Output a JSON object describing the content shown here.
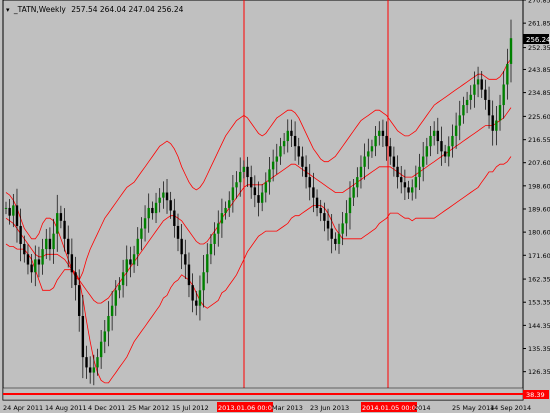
{
  "symbol_label": "_TATN,Weekly",
  "ohlc_label": "257.54 264.04 247.04 256.24",
  "last_price_label": "256.24",
  "indicator_value_label": "38.39",
  "colors": {
    "background": "#c0c0c0",
    "bull_candle": "#008000",
    "bear_candle": "#000000",
    "bands": "#ff0000",
    "vertical_lines": "#ff0000",
    "label_bg_red": "#ff0000",
    "grid": "#a0a0a0"
  },
  "chart_data": {
    "type": "candlestick",
    "title": "",
    "y_axis": {
      "range": [
        120.0,
        270.85
      ],
      "tick_labels": [
        "270.85",
        "261.85",
        "252.35",
        "243.85",
        "234.85",
        "225.60",
        "216.55",
        "207.60",
        "198.60",
        "189.60",
        "180.60",
        "171.60",
        "162.35",
        "153.35",
        "144.35",
        "135.35",
        "126.35"
      ]
    },
    "x_axis": {
      "tick_labels": [
        "24 Apr 2011",
        "14 Aug 2011",
        "4 Dec 2011",
        "25 Mar 2012",
        "15 Jul 2012",
        "2013.01.06 00:00",
        "Mar 2013",
        "23 Jun 2013",
        "2014.01.05 00:00",
        "2014",
        "25 May 2014",
        "14 Sep 2014"
      ]
    },
    "highlighted_dates": [
      "2013.01.06 00:00",
      "2014.01.05 00:00"
    ],
    "series": [
      {
        "name": "price_close_path",
        "values": [
          190,
          187,
          191,
          183,
          176,
          172,
          168,
          165,
          170,
          168,
          174,
          178,
          174,
          180,
          188,
          185,
          178,
          172,
          165,
          160,
          148,
          132,
          128,
          126,
          128,
          132,
          138,
          142,
          148,
          152,
          158,
          160,
          165,
          170,
          168,
          172,
          178,
          182,
          186,
          190,
          188,
          192,
          194,
          196,
          193,
          189,
          183,
          178,
          172,
          168,
          160,
          154,
          152,
          158,
          165,
          172,
          176,
          180,
          184,
          188,
          190,
          193,
          198,
          200,
          204,
          206,
          202,
          198,
          195,
          192,
          196,
          200,
          205,
          208,
          210,
          214,
          216,
          220,
          218,
          214,
          210,
          206,
          202,
          198,
          194,
          190,
          188,
          185,
          182,
          178,
          176,
          180,
          184,
          188,
          194,
          198,
          202,
          206,
          210,
          212,
          214,
          218,
          220,
          218,
          214,
          210,
          206,
          202,
          200,
          198,
          196,
          198,
          202,
          206,
          210,
          214,
          218,
          220,
          216,
          212,
          210,
          214,
          218,
          222,
          226,
          230,
          232,
          234,
          238,
          240,
          236,
          232,
          226,
          220,
          224,
          230,
          238,
          246,
          256
        ]
      },
      {
        "name": "upper_band",
        "values": [
          196,
          195,
          193,
          190,
          186,
          182,
          180,
          178,
          178,
          180,
          184,
          186,
          186,
          185,
          182,
          178,
          174,
          170,
          166,
          163,
          162,
          165,
          170,
          174,
          177,
          180,
          183,
          186,
          188,
          190,
          192,
          194,
          196,
          198,
          199,
          200,
          202,
          204,
          206,
          208,
          210,
          212,
          214,
          215,
          216,
          215,
          213,
          210,
          206,
          203,
          200,
          198,
          197,
          198,
          200,
          203,
          206,
          209,
          212,
          215,
          218,
          220,
          222,
          224,
          225,
          226,
          225,
          223,
          221,
          219,
          218,
          219,
          221,
          223,
          225,
          226,
          227,
          228,
          228,
          227,
          225,
          222,
          219,
          216,
          213,
          211,
          209,
          208,
          208,
          209,
          210,
          212,
          214,
          216,
          218,
          220,
          222,
          224,
          225,
          226,
          227,
          228,
          228,
          227,
          226,
          224,
          222,
          220,
          219,
          218,
          218,
          219,
          220,
          222,
          224,
          226,
          228,
          230,
          231,
          232,
          233,
          234,
          235,
          236,
          237,
          238,
          239,
          240,
          241,
          242,
          242,
          241,
          240,
          240,
          240,
          241,
          243,
          246,
          248
        ]
      },
      {
        "name": "middle_band",
        "values": [
          186,
          185,
          184,
          182,
          180,
          178,
          176,
          174,
          172,
          171,
          171,
          172,
          172,
          172,
          172,
          171,
          170,
          168,
          166,
          164,
          162,
          160,
          158,
          156,
          154,
          153,
          153,
          154,
          155,
          157,
          159,
          161,
          163,
          165,
          167,
          169,
          171,
          173,
          175,
          177,
          179,
          181,
          183,
          185,
          186,
          187,
          187,
          186,
          185,
          183,
          181,
          179,
          177,
          176,
          176,
          177,
          179,
          181,
          183,
          186,
          188,
          190,
          192,
          194,
          196,
          198,
          199,
          199,
          199,
          199,
          199,
          200,
          201,
          202,
          203,
          204,
          205,
          206,
          207,
          207,
          206,
          205,
          204,
          203,
          202,
          201,
          200,
          199,
          198,
          197,
          196,
          196,
          196,
          197,
          198,
          199,
          200,
          201,
          202,
          203,
          204,
          205,
          206,
          206,
          206,
          206,
          205,
          204,
          203,
          202,
          202,
          202,
          203,
          204,
          205,
          206,
          207,
          208,
          209,
          210,
          211,
          212,
          213,
          214,
          215,
          216,
          217,
          218,
          219,
          220,
          221,
          222,
          222,
          222,
          223,
          224,
          225,
          227,
          229
        ]
      },
      {
        "name": "lower_band",
        "values": [
          176,
          175,
          175,
          174,
          174,
          174,
          172,
          170,
          166,
          162,
          158,
          158,
          158,
          159,
          162,
          164,
          166,
          166,
          166,
          165,
          162,
          155,
          146,
          138,
          131,
          126,
          123,
          122,
          122,
          124,
          126,
          128,
          130,
          132,
          135,
          138,
          140,
          142,
          144,
          146,
          148,
          150,
          152,
          155,
          156,
          159,
          161,
          162,
          164,
          163,
          162,
          160,
          157,
          154,
          152,
          151,
          152,
          153,
          154,
          157,
          158,
          160,
          162,
          164,
          167,
          170,
          173,
          175,
          177,
          179,
          180,
          181,
          181,
          181,
          181,
          182,
          183,
          184,
          186,
          187,
          187,
          188,
          189,
          190,
          191,
          191,
          191,
          190,
          188,
          185,
          182,
          180,
          178,
          178,
          178,
          178,
          178,
          178,
          179,
          180,
          181,
          182,
          184,
          185,
          186,
          188,
          188,
          188,
          187,
          186,
          186,
          185,
          186,
          186,
          186,
          186,
          186,
          186,
          187,
          188,
          189,
          190,
          191,
          192,
          193,
          194,
          195,
          196,
          197,
          198,
          200,
          202,
          204,
          204,
          206,
          207,
          207,
          208,
          210
        ]
      }
    ]
  }
}
